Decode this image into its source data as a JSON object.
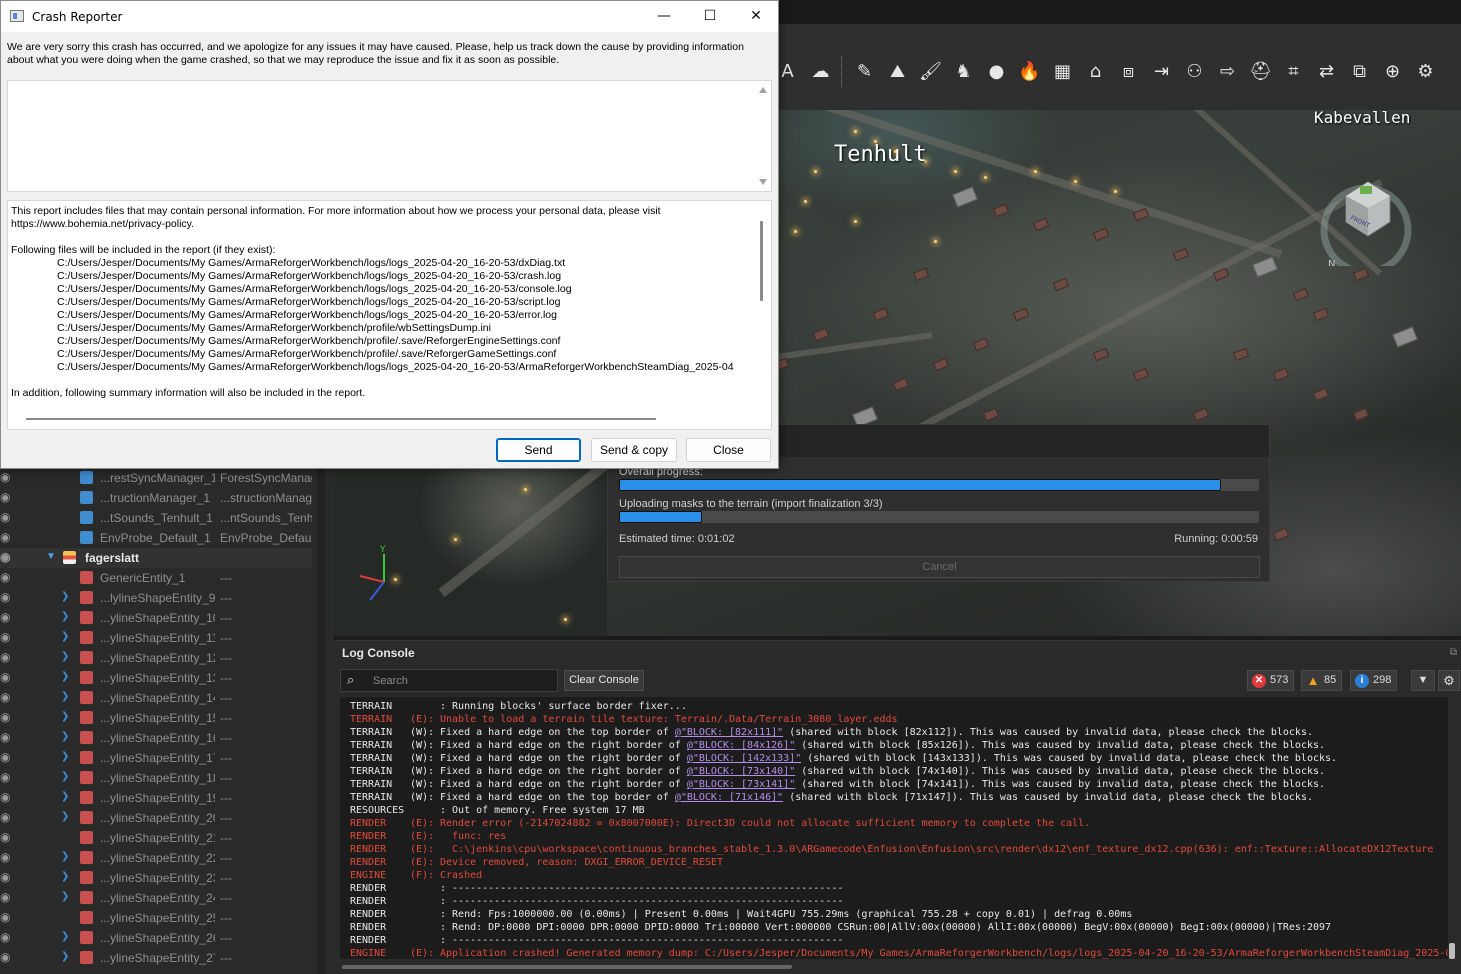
{
  "crash_reporter": {
    "title": "Crash Reporter",
    "intro": "We are very sorry this crash has occurred, and we apologize for any issues it may have caused. Please, help us track down the cause by providing information about what you were doing when the game crashed, so that we may reproduce the issue and fix it as soon as possible.",
    "comment_value": "",
    "report_lines": [
      "This report includes files that may contain personal information. For more information about how we process your personal data, please visit",
      "https://www.bohemia.net/privacy-policy.",
      "",
      "Following files will be included in the report (if they exist):"
    ],
    "files": [
      "C:/Users/Jesper/Documents/My Games/ArmaReforgerWorkbench/logs/logs_2025-04-20_16-20-53/dxDiag.txt",
      "C:/Users/Jesper/Documents/My Games/ArmaReforgerWorkbench/logs/logs_2025-04-20_16-20-53/crash.log",
      "C:/Users/Jesper/Documents/My Games/ArmaReforgerWorkbench/logs/logs_2025-04-20_16-20-53/console.log",
      "C:/Users/Jesper/Documents/My Games/ArmaReforgerWorkbench/logs/logs_2025-04-20_16-20-53/script.log",
      "C:/Users/Jesper/Documents/My Games/ArmaReforgerWorkbench/logs/logs_2025-04-20_16-20-53/error.log",
      "C:/Users/Jesper/Documents/My Games/ArmaReforgerWorkbench/profile/wbSettingsDump.ini",
      "C:/Users/Jesper/Documents/My Games/ArmaReforgerWorkbench/profile/.save/ReforgerEngineSettings.conf",
      "C:/Users/Jesper/Documents/My Games/ArmaReforgerWorkbench/profile/.save/ReforgerGameSettings.conf",
      "C:/Users/Jesper/Documents/My Games/ArmaReforgerWorkbench/logs/logs_2025-04-20_16-20-53/ArmaReforgerWorkbenchSteamDiag_2025-04"
    ],
    "summary_line": "In addition, following summary information will also be included in the report.",
    "send_label": "Send",
    "send_copy_label": "Send & copy",
    "close_label": "Close",
    "minimize_glyph": "—",
    "maximize_glyph": "☐",
    "close_glyph": "✕"
  },
  "viewport": {
    "label_tenhult": "Tenhult",
    "label_kabevallen": "Kabevallen",
    "gizmo_front": "FRONT",
    "gizmo_n": "N",
    "axis_y": "Y"
  },
  "progress": {
    "overall_label": "Overall progress:",
    "overall_fraction": 0.94,
    "step_label": "Uploading masks to the terrain (import finalization 3/3)",
    "step_fraction": 0.13,
    "estimated": "Estimated time: 0:01:02",
    "running": "Running: 0:00:59",
    "cancel_label": "Cancel"
  },
  "outliner": {
    "rows": [
      {
        "name": "...restSyncManager_1",
        "type": "ForestSyncManag",
        "color": "#3f8ccf",
        "arrow": ""
      },
      {
        "name": "...tructionManager_1",
        "type": "...structionManag",
        "color": "#3f8ccf",
        "arrow": ""
      },
      {
        "name": "...tSounds_Tenhult_1",
        "type": "...ntSounds_Tenh",
        "color": "#3f8ccf",
        "arrow": ""
      },
      {
        "name": "EnvProbe_Default_1",
        "type": "EnvProbe_Defaul",
        "color": "#3f8ccf",
        "arrow": ""
      },
      {
        "name": "fagerslatt",
        "type": "",
        "color": "",
        "arrow": "▼"
      },
      {
        "name": "GenericEntity_1",
        "type": "---",
        "color": "#c94f4f",
        "arrow": ""
      },
      {
        "name": "...lylineShapeEntity_9",
        "type": "---",
        "color": "#c94f4f",
        "arrow": "❯"
      },
      {
        "name": "...ylineShapeEntity_10",
        "type": "---",
        "color": "#c94f4f",
        "arrow": "❯"
      },
      {
        "name": "...ylineShapeEntity_11",
        "type": "---",
        "color": "#c94f4f",
        "arrow": "❯"
      },
      {
        "name": "...ylineShapeEntity_12",
        "type": "---",
        "color": "#c94f4f",
        "arrow": "❯"
      },
      {
        "name": "...ylineShapeEntity_13",
        "type": "---",
        "color": "#c94f4f",
        "arrow": "❯"
      },
      {
        "name": "...ylineShapeEntity_14",
        "type": "---",
        "color": "#c94f4f",
        "arrow": "❯"
      },
      {
        "name": "...ylineShapeEntity_15",
        "type": "---",
        "color": "#c94f4f",
        "arrow": "❯"
      },
      {
        "name": "...ylineShapeEntity_16",
        "type": "---",
        "color": "#c94f4f",
        "arrow": "❯"
      },
      {
        "name": "...ylineShapeEntity_17",
        "type": "---",
        "color": "#c94f4f",
        "arrow": "❯"
      },
      {
        "name": "...ylineShapeEntity_18",
        "type": "---",
        "color": "#c94f4f",
        "arrow": "❯"
      },
      {
        "name": "...ylineShapeEntity_19",
        "type": "---",
        "color": "#c94f4f",
        "arrow": "❯"
      },
      {
        "name": "...ylineShapeEntity_20",
        "type": "---",
        "color": "#c94f4f",
        "arrow": "❯"
      },
      {
        "name": "...ylineShapeEntity_21",
        "type": "---",
        "color": "#c94f4f",
        "arrow": ""
      },
      {
        "name": "...ylineShapeEntity_22",
        "type": "---",
        "color": "#c94f4f",
        "arrow": "❯"
      },
      {
        "name": "...ylineShapeEntity_23",
        "type": "---",
        "color": "#c94f4f",
        "arrow": "❯"
      },
      {
        "name": "...ylineShapeEntity_24",
        "type": "---",
        "color": "#c94f4f",
        "arrow": "❯"
      },
      {
        "name": "...ylineShapeEntity_25",
        "type": "---",
        "color": "#c94f4f",
        "arrow": ""
      },
      {
        "name": "...ylineShapeEntity_26",
        "type": "---",
        "color": "#c94f4f",
        "arrow": "❯"
      },
      {
        "name": "...ylineShapeEntity_27",
        "type": "---",
        "color": "#c94f4f",
        "arrow": "❯"
      }
    ]
  },
  "log_console": {
    "title": "Log Console",
    "search_placeholder": "Search",
    "clear_label": "Clear Console",
    "errors": "573",
    "warnings": "85",
    "infos": "298",
    "lines": [
      {
        "m": "TERRAIN",
        "l": "",
        "t": ": Running blocks' surface border fixer...",
        "e": false
      },
      {
        "m": "TERRAIN",
        "l": "(E):",
        "t": "Unable to load a terrain tile texture: Terrain/.Data/Terrain_3080_layer.edds",
        "e": true
      },
      {
        "m": "TERRAIN",
        "l": "(W):",
        "t": "Fixed a hard edge on the top border of ",
        "k": "@\"BLOCK: [82x111]\"",
        "r": " (shared with block [82x112]). This was caused by invalid data, please check the blocks.",
        "e": false
      },
      {
        "m": "TERRAIN",
        "l": "(W):",
        "t": "Fixed a hard edge on the right border of ",
        "k": "@\"BLOCK: [84x126]\"",
        "r": " (shared with block [85x126]). This was caused by invalid data, please check the blocks.",
        "e": false
      },
      {
        "m": "TERRAIN",
        "l": "(W):",
        "t": "Fixed a hard edge on the right border of ",
        "k": "@\"BLOCK: [142x133]\"",
        "r": " (shared with block [143x133]). This was caused by invalid data, please check the blocks.",
        "e": false
      },
      {
        "m": "TERRAIN",
        "l": "(W):",
        "t": "Fixed a hard edge on the right border of ",
        "k": "@\"BLOCK: [73x140]\"",
        "r": " (shared with block [74x140]). This was caused by invalid data, please check the blocks.",
        "e": false
      },
      {
        "m": "TERRAIN",
        "l": "(W):",
        "t": "Fixed a hard edge on the right border of ",
        "k": "@\"BLOCK: [73x141]\"",
        "r": " (shared with block [74x141]). This was caused by invalid data, please check the blocks.",
        "e": false
      },
      {
        "m": "TERRAIN",
        "l": "(W):",
        "t": "Fixed a hard edge on the top border of ",
        "k": "@\"BLOCK: [71x146]\"",
        "r": " (shared with block [71x147]). This was caused by invalid data, please check the blocks.",
        "e": false
      },
      {
        "m": "RESOURCES",
        "l": "",
        "t": ": Out of memory. Free system 17 MB",
        "e": false
      },
      {
        "m": "RENDER",
        "l": "(E):",
        "t": "Render error (-2147024882 = 0x8007000E): Direct3D could not allocate sufficient memory to complete the call.",
        "e": true
      },
      {
        "m": "RENDER",
        "l": "(E):",
        "t": "  func: res",
        "e": true
      },
      {
        "m": "RENDER",
        "l": "(E):",
        "t": "  C:\\jenkins\\cpu\\workspace\\continuous_branches_stable_1.3.0\\ARGamecode\\Enfusion\\Enfusion\\src\\render\\dx12\\enf_texture_dx12.cpp(636): enf::Texture::AllocateDX12Texture",
        "e": true
      },
      {
        "m": "RENDER",
        "l": "(E):",
        "t": "Device removed, reason: DXGI_ERROR_DEVICE_RESET",
        "e": true
      },
      {
        "m": "ENGINE",
        "l": "(F):",
        "t": "Crashed",
        "e": true
      },
      {
        "m": "RENDER",
        "l": "",
        "t": ": -----------------------------------------------------------------",
        "e": false
      },
      {
        "m": "RENDER",
        "l": "",
        "t": ": -----------------------------------------------------------------",
        "e": false
      },
      {
        "m": "RENDER",
        "l": "",
        "t": ": Rend: Fps:1000000.00 (0.00ms) | Present 0.00ms | Wait4GPU 755.29ms (graphical 755.28 + copy 0.01) | defrag 0.00ms",
        "e": false
      },
      {
        "m": "RENDER",
        "l": "",
        "t": ": Rend: DP:0000 DPI:0000 DPR:0000 DPID:0000 Tri:00000 Vert:000000 CSRun:00|AllV:00x(00000) AllI:00x(00000) BegV:00x(00000) BegI:00x(00000)|TRes:2097",
        "e": false
      },
      {
        "m": "RENDER",
        "l": "",
        "t": ": -----------------------------------------------------------------",
        "e": false
      },
      {
        "m": "ENGINE",
        "l": "(E):",
        "t": "Application crashed! Generated memory dump: C:/Users/Jesper/Documents/My Games/ArmaReforgerWorkbench/logs/logs_2025-04-20_16-20-53/ArmaReforgerWorkbenchSteamDiag_2025-0",
        "e": true
      }
    ]
  },
  "toolbar_icons": [
    "text-tool-icon",
    "weather-icon",
    "ruler-icon",
    "map-icon",
    "brush-icon",
    "prefab-icon",
    "sphere-icon",
    "fire-icon",
    "grid-icon",
    "terrain-icon",
    "box-icon",
    "import-icon",
    "hierarchy-icon",
    "export-icon",
    "hat-icon",
    "shape-icon",
    "swap-icon",
    "layers-icon",
    "globe-icon",
    "settings-icon"
  ],
  "toolbar_glyphs": [
    "A",
    "☁",
    "✎",
    "⛰",
    "🖌",
    "♞",
    "●",
    "🔥",
    "▦",
    "⌂",
    "⧈",
    "⇥",
    "⚇",
    "⇨",
    "⛑",
    "⌗",
    "⇄",
    "⧉",
    "⊕",
    "⚙"
  ]
}
